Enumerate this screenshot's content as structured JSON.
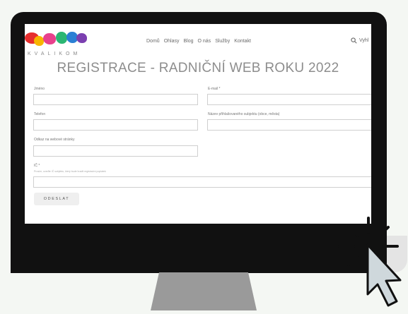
{
  "brand": {
    "name": "KVALIKOM"
  },
  "nav": {
    "items": [
      "Domů",
      "Ohlasy",
      "Blog",
      "O nás",
      "Služby",
      "Kontakt"
    ]
  },
  "search": {
    "label": "Vyhl"
  },
  "page": {
    "title": "REGISTRACE - RADNIČNÍ WEB ROKU 2022"
  },
  "form": {
    "jmeno_label": "Jméno",
    "email_label": "E-mail *",
    "telefon_label": "Telefon",
    "subjekt_label": "Název přihlašovaného subjektu (obce, města)",
    "odkaz_label": "Odkaz na webové stránky",
    "ic_label": "IČ *",
    "ic_hint": "Prosím, uveďte IČ subjektu, který bude hradit registrační poplatek",
    "submit_label": "ODESLAT"
  },
  "colors": {
    "background": "#f4f7f3",
    "monitor": "#111111",
    "logo": [
      "#e62e2e",
      "#f7b500",
      "#e8408c",
      "#2bb673",
      "#2b7fd4",
      "#7b3fb0"
    ]
  }
}
